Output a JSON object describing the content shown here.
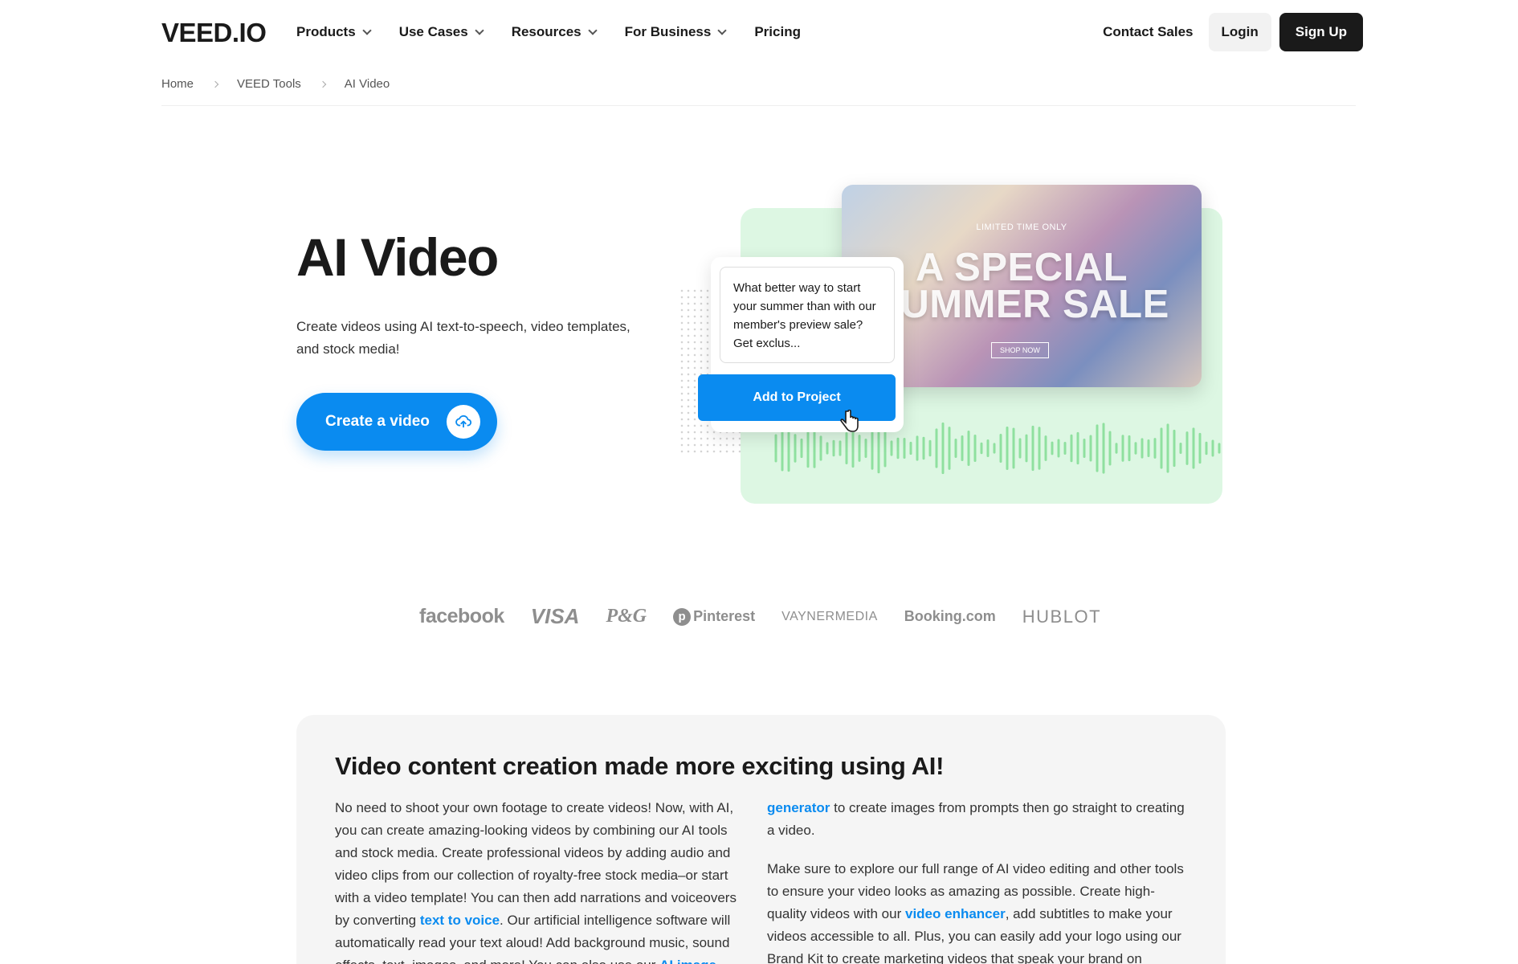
{
  "brand": {
    "logo_text": "VEED.IO"
  },
  "nav": {
    "items": [
      {
        "label": "Products"
      },
      {
        "label": "Use Cases"
      },
      {
        "label": "Resources"
      },
      {
        "label": "For Business"
      },
      {
        "label": "Pricing"
      }
    ],
    "contact_label": "Contact Sales",
    "login_label": "Login",
    "signup_label": "Sign Up"
  },
  "breadcrumb": [
    "Home",
    "VEED Tools",
    "AI Video"
  ],
  "hero": {
    "title": "AI Video",
    "subtitle": "Create videos using AI text-to-speech, video templates, and stock media!",
    "cta_label": "Create a video",
    "image": {
      "prompt_text": "What better way to start your summer than with our member's preview sale? Get exclus...",
      "add_button_label": "Add to Project",
      "banner_small": "LIMITED TIME ONLY",
      "banner_line1": "A SPECIAL",
      "banner_line2": "SUMMER SALE",
      "banner_shop": "SHOP NOW"
    }
  },
  "logos": [
    "facebook",
    "VISA",
    "P&G",
    "Pinterest",
    "VAYNERMEDIA",
    "Booking.com",
    "HUBLOT"
  ],
  "content": {
    "heading": "Video content creation made more exciting using AI!",
    "col1_part1": "No need to shoot your own footage to create videos! Now, with AI, you can create amazing-looking videos by combining our AI tools and stock media. Create professional videos by adding audio and video clips from our collection of royalty-free stock media–or start with a video template! You can then add narrations and voiceovers by converting ",
    "col1_link1": "text to voice",
    "col1_part2": ". Our artificial intelligence software will automatically read your text aloud! Add background music, sound effects, text, images, and more! You can also use our ",
    "col1_link2": "AI image",
    "col2_link0": "generator",
    "col2_p1_rest": " to create images from prompts then go straight to creating a video.",
    "col2_p2_part1": "Make sure to explore our full range of AI video editing and other tools to ensure your video looks as amazing as possible. Create high-quality videos with our ",
    "col2_p2_link": "video enhancer",
    "col2_p2_part2": ", add subtitles to make your videos accessible to all. Plus, you can easily add your logo using our Brand Kit to create marketing videos that speak your brand on"
  },
  "colors": {
    "accent": "#0a8bf0",
    "dark": "#1a1a1a",
    "green_bg": "#ddf7e3",
    "panel_bg": "#f5f5f5"
  }
}
